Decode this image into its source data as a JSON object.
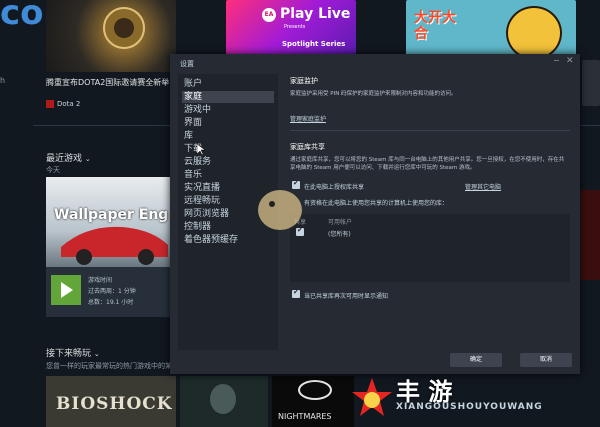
{
  "background": {
    "news": {
      "headline": "腾重宣布DOTA2国际邀请赛全新举",
      "tag": "Dota 2"
    },
    "featured_tiles": {
      "ea_title": "Play Live",
      "ea_presents": "Presents",
      "ea_series": "Spotlight Series",
      "game_title": "大开大合"
    },
    "recent": {
      "title": "最近游戏",
      "today": "今天",
      "game_title": "Wallpaper Eng",
      "playtime_label": "游戏时间",
      "last_two_weeks": "过去两周：1 分钟",
      "total": "总数：19.1 小时"
    },
    "next": {
      "title": "接下来畅玩",
      "subtitle": "您曾一样的玩家最常玩的热门游戏中的某个"
    },
    "bottom_tiles": [
      "BIOSHOCK",
      "NIGHTMARES"
    ]
  },
  "dialog": {
    "title": "设置",
    "nav_items": [
      {
        "label": "账户",
        "selected": false
      },
      {
        "label": "家庭",
        "selected": true
      },
      {
        "label": "游戏中",
        "selected": false
      },
      {
        "label": "界面",
        "selected": false
      },
      {
        "label": "库",
        "selected": false
      },
      {
        "label": "下载",
        "selected": false
      },
      {
        "label": "云服务",
        "selected": false
      },
      {
        "label": "音乐",
        "selected": false
      },
      {
        "label": "实况直播",
        "selected": false
      },
      {
        "label": "远程畅玩",
        "selected": false
      },
      {
        "label": "网页浏览器",
        "selected": false
      },
      {
        "label": "控制器",
        "selected": false
      },
      {
        "label": "着色器预缓存",
        "selected": false
      }
    ],
    "family_view": {
      "heading": "家庭监护",
      "description": "家庭监护采用受 PIN 码保护的家庭监护来限制对内容和功能的访问。",
      "manage_link": "管理家庭监护"
    },
    "library_sharing": {
      "heading": "家庭库共享",
      "description": "通过家庭库共享，您可以将您的 Steam 库与同一台电脑上的其他用户共享。您一旦授权，在您不使用时，存在共享电脑的 Steam 用户便可以访问、下载并运行您库中可玩的 Steam 游戏。",
      "authorize_label": "在此电脑上授权库共享",
      "manage_devices_link": "管理其它电脑",
      "eligible_label": "有资格在此电脑上使用您共享的计算机上使用您的库：",
      "col_share": "共享",
      "col_account": "可用帐户",
      "row_account": "(您所有)",
      "notify_label": "当已共享库再次可用时显示通知"
    },
    "ok_label": "确定",
    "cancel_label": "取消"
  },
  "watermark": {
    "text": "丰 游",
    "sub": "XIANGOUSHOUYOUWANG"
  },
  "colors": {
    "accent": "#62a63a",
    "dialog_bg": "#262b33",
    "selected_nav": "#3d4450"
  }
}
